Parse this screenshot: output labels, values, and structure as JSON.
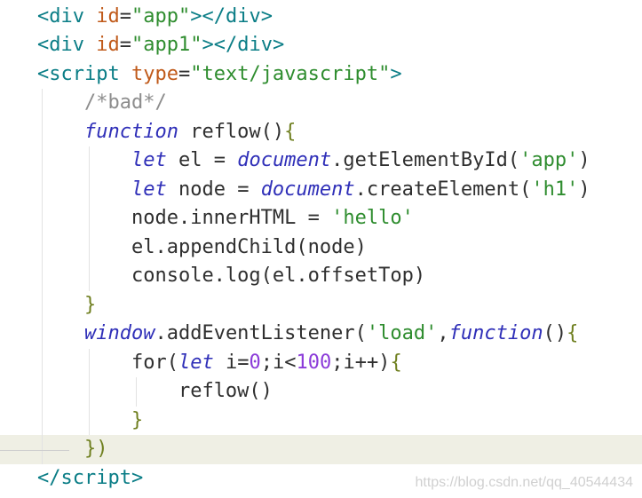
{
  "editor": {
    "lines": [
      {
        "tokens": [
          {
            "t": "<",
            "c": "t-tag"
          },
          {
            "t": "div",
            "c": "t-tag"
          },
          {
            "t": " ",
            "c": "t-plain"
          },
          {
            "t": "id",
            "c": "t-attr"
          },
          {
            "t": "=",
            "c": "t-plain"
          },
          {
            "t": "\"app\"",
            "c": "t-str"
          },
          {
            "t": "></",
            "c": "t-tag"
          },
          {
            "t": "div",
            "c": "t-tag"
          },
          {
            "t": ">",
            "c": "t-tag"
          }
        ]
      },
      {
        "tokens": [
          {
            "t": "<",
            "c": "t-tag"
          },
          {
            "t": "div",
            "c": "t-tag"
          },
          {
            "t": " ",
            "c": "t-plain"
          },
          {
            "t": "id",
            "c": "t-attr"
          },
          {
            "t": "=",
            "c": "t-plain"
          },
          {
            "t": "\"app1\"",
            "c": "t-str"
          },
          {
            "t": "></",
            "c": "t-tag"
          },
          {
            "t": "div",
            "c": "t-tag"
          },
          {
            "t": ">",
            "c": "t-tag"
          }
        ]
      },
      {
        "tokens": [
          {
            "t": "<",
            "c": "t-tag"
          },
          {
            "t": "script",
            "c": "t-tag"
          },
          {
            "t": " ",
            "c": "t-plain"
          },
          {
            "t": "type",
            "c": "t-attr"
          },
          {
            "t": "=",
            "c": "t-plain"
          },
          {
            "t": "\"text/javascript\"",
            "c": "t-str"
          },
          {
            "t": ">",
            "c": "t-tag"
          }
        ]
      },
      {
        "tokens": [
          {
            "t": "    ",
            "c": "t-plain"
          },
          {
            "t": "/*bad*/",
            "c": "t-cmt"
          }
        ]
      },
      {
        "tokens": [
          {
            "t": "    ",
            "c": "t-plain"
          },
          {
            "t": "function",
            "c": "t-kw"
          },
          {
            "t": " reflow",
            "c": "t-fn"
          },
          {
            "t": "()",
            "c": "t-punc"
          },
          {
            "t": "{",
            "c": "t-brace"
          }
        ]
      },
      {
        "tokens": [
          {
            "t": "        ",
            "c": "t-plain"
          },
          {
            "t": "let",
            "c": "t-kw"
          },
          {
            "t": " el = ",
            "c": "t-plain"
          },
          {
            "t": "document",
            "c": "t-kw"
          },
          {
            "t": ".getElementById(",
            "c": "t-plain"
          },
          {
            "t": "'app'",
            "c": "t-str"
          },
          {
            "t": ")",
            "c": "t-plain"
          }
        ]
      },
      {
        "tokens": [
          {
            "t": "        ",
            "c": "t-plain"
          },
          {
            "t": "let",
            "c": "t-kw"
          },
          {
            "t": " node = ",
            "c": "t-plain"
          },
          {
            "t": "document",
            "c": "t-kw"
          },
          {
            "t": ".createElement(",
            "c": "t-plain"
          },
          {
            "t": "'h1'",
            "c": "t-str"
          },
          {
            "t": ")",
            "c": "t-plain"
          }
        ]
      },
      {
        "tokens": [
          {
            "t": "        ",
            "c": "t-plain"
          },
          {
            "t": "node.innerHTML = ",
            "c": "t-plain"
          },
          {
            "t": "'hello'",
            "c": "t-str"
          }
        ]
      },
      {
        "tokens": [
          {
            "t": "        ",
            "c": "t-plain"
          },
          {
            "t": "el.appendChild(node)",
            "c": "t-plain"
          }
        ]
      },
      {
        "tokens": [
          {
            "t": "        ",
            "c": "t-plain"
          },
          {
            "t": "console.log(el.offsetTop)",
            "c": "t-plain"
          }
        ]
      },
      {
        "tokens": [
          {
            "t": "    ",
            "c": "t-plain"
          },
          {
            "t": "}",
            "c": "t-brace"
          }
        ]
      },
      {
        "tokens": [
          {
            "t": "    ",
            "c": "t-plain"
          },
          {
            "t": "window",
            "c": "t-kw"
          },
          {
            "t": ".addEventListener(",
            "c": "t-plain"
          },
          {
            "t": "'load'",
            "c": "t-str"
          },
          {
            "t": ",",
            "c": "t-plain"
          },
          {
            "t": "function",
            "c": "t-kw"
          },
          {
            "t": "()",
            "c": "t-punc"
          },
          {
            "t": "{",
            "c": "t-brace"
          }
        ]
      },
      {
        "tokens": [
          {
            "t": "        ",
            "c": "t-plain"
          },
          {
            "t": "for(",
            "c": "t-plain"
          },
          {
            "t": "let",
            "c": "t-kw"
          },
          {
            "t": " i=",
            "c": "t-plain"
          },
          {
            "t": "0",
            "c": "t-num"
          },
          {
            "t": ";i<",
            "c": "t-plain"
          },
          {
            "t": "100",
            "c": "t-num"
          },
          {
            "t": ";i++)",
            "c": "t-plain"
          },
          {
            "t": "{",
            "c": "t-brace"
          }
        ]
      },
      {
        "tokens": [
          {
            "t": "            ",
            "c": "t-plain"
          },
          {
            "t": "reflow()",
            "c": "t-plain"
          }
        ]
      },
      {
        "tokens": [
          {
            "t": "        ",
            "c": "t-plain"
          },
          {
            "t": "}",
            "c": "t-brace"
          }
        ]
      },
      {
        "tokens": [
          {
            "t": "    ",
            "c": "t-plain"
          },
          {
            "t": "})",
            "c": "t-brace"
          }
        ],
        "current": true
      },
      {
        "tokens": [
          {
            "t": "</",
            "c": "t-tag"
          },
          {
            "t": "script",
            "c": "t-tag"
          },
          {
            "t": ">",
            "c": "t-tag"
          }
        ]
      }
    ]
  },
  "watermark": "https://blog.csdn.net/qq_40544434",
  "colors": {
    "tag": "#0a7d86",
    "attribute": "#c05a1a",
    "string": "#2f8d2f",
    "comment": "#8d8d8d",
    "keyword": "#2f2fb8",
    "number": "#8b3bd9",
    "current_line": "#efefe4"
  }
}
